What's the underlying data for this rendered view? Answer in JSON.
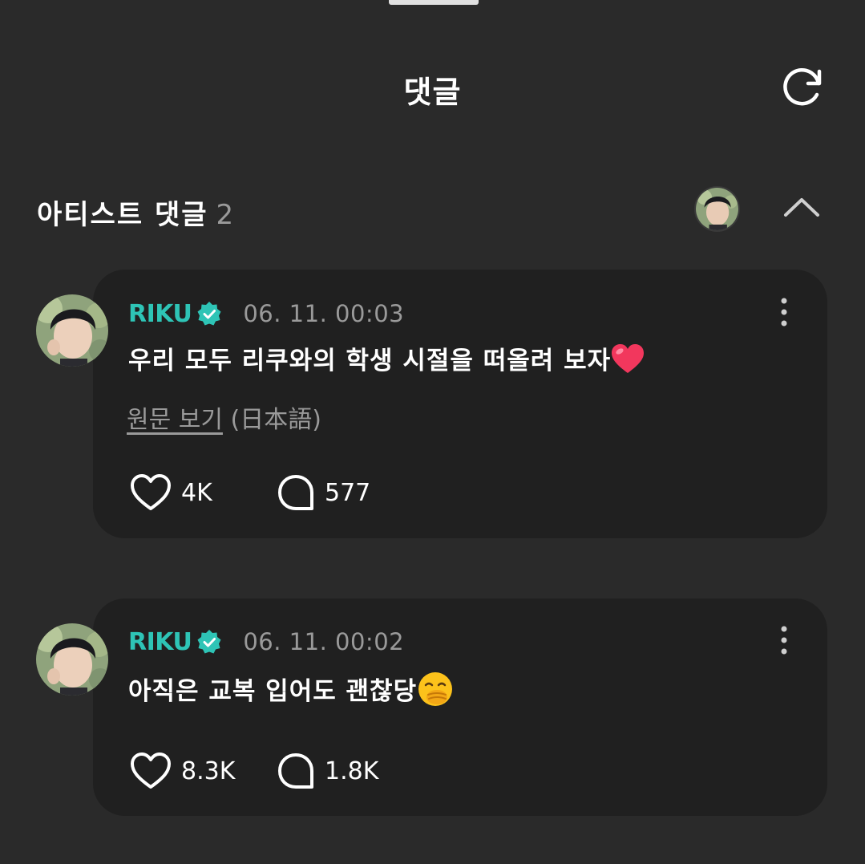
{
  "header": {
    "title": "댓글",
    "refresh_icon": "refresh-icon"
  },
  "artist_section": {
    "title": "아티스트 댓글",
    "count": "2",
    "collapse_icon": "chevron-up-icon"
  },
  "comments": [
    {
      "username": "RIKU",
      "verified": true,
      "timestamp": "06. 11. 00:03",
      "text": "우리 모두 리쿠와의 학생 시절을 떠올려 보자",
      "emoji": "red-heart",
      "translation": {
        "link": "원문 보기",
        "language": "(日本語)"
      },
      "likes": "4K",
      "replies": "577"
    },
    {
      "username": "RIKU",
      "verified": true,
      "timestamp": "06. 11. 00:02",
      "text": "아직은 교복 입어도 괜찮당",
      "emoji": "face-with-hand-over-mouth",
      "likes": "8.3K",
      "replies": "1.8K"
    }
  ],
  "colors": {
    "background": "#2a2a2a",
    "card": "#202020",
    "username": "#2ec4b6",
    "muted": "#9a9a9a",
    "verified_badge": "#2ec4b6"
  }
}
